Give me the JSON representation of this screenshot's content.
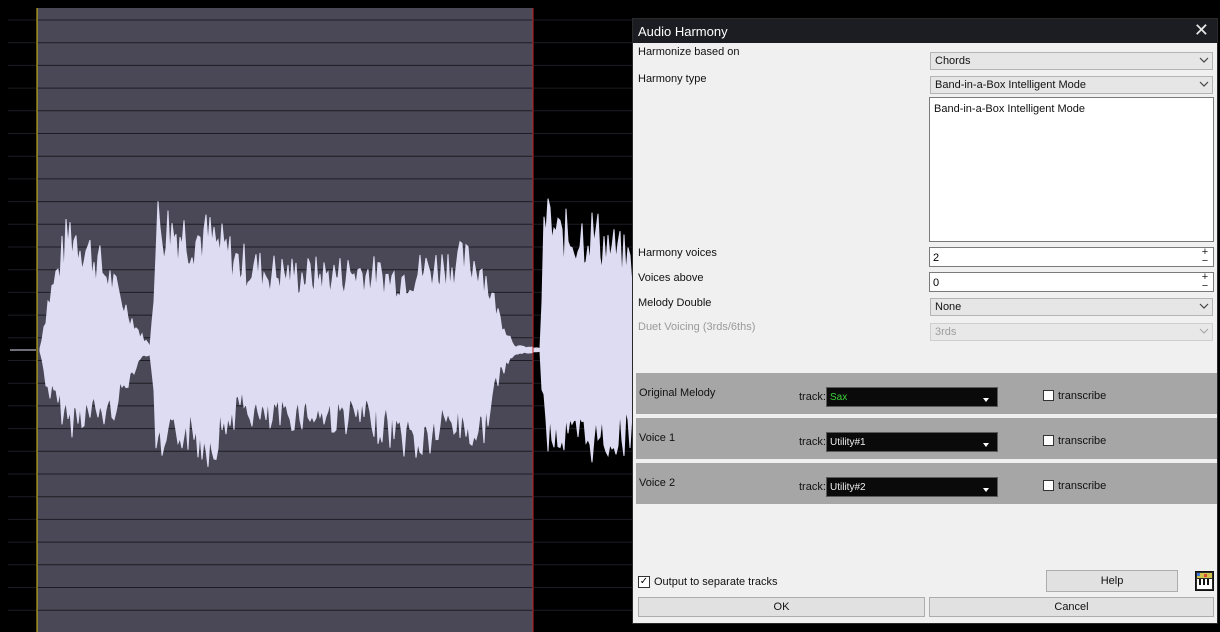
{
  "dialog": {
    "title": "Audio Harmony",
    "close_glyph": "✕",
    "harmonize_label": "Harmonize based on",
    "harmonize_value": "Chords",
    "harmony_type_label": "Harmony type",
    "harmony_type_value": "Band-in-a-Box Intelligent Mode",
    "description": "Band-in-a-Box Intelligent Mode",
    "harmony_voices_label": "Harmony voices",
    "harmony_voices_value": "2",
    "voices_above_label": "Voices above",
    "voices_above_value": "0",
    "melody_double_label": "Melody Double",
    "melody_double_value": "None",
    "duet_voicing_label": "Duet Voicing (3rds/6ths)",
    "duet_voicing_value": "3rds",
    "spin_plus": "+",
    "spin_minus": "−",
    "track_prefix": "track:",
    "transcribe_label": "transcribe",
    "tracks": [
      {
        "name": "Original Melody",
        "track": "Sax",
        "track_color": "#3cd13c"
      },
      {
        "name": "Voice 1",
        "track": "Utility#1",
        "track_color": "#f0f0f0"
      },
      {
        "name": "Voice 2",
        "track": "Utility#2",
        "track_color": "#f0f0f0"
      }
    ],
    "output_label": "Output to separate tracks",
    "output_checked": "✓",
    "help_label": "Help",
    "ok_label": "OK",
    "cancel_label": "Cancel"
  },
  "colors": {
    "waveform": "#dddcf2",
    "selection": "#4a4857",
    "playhead": "#d8c010",
    "selection_end": "#c02020"
  },
  "icons": [
    "close-icon",
    "chevron-down-icon",
    "piano-keyboard-icon"
  ]
}
